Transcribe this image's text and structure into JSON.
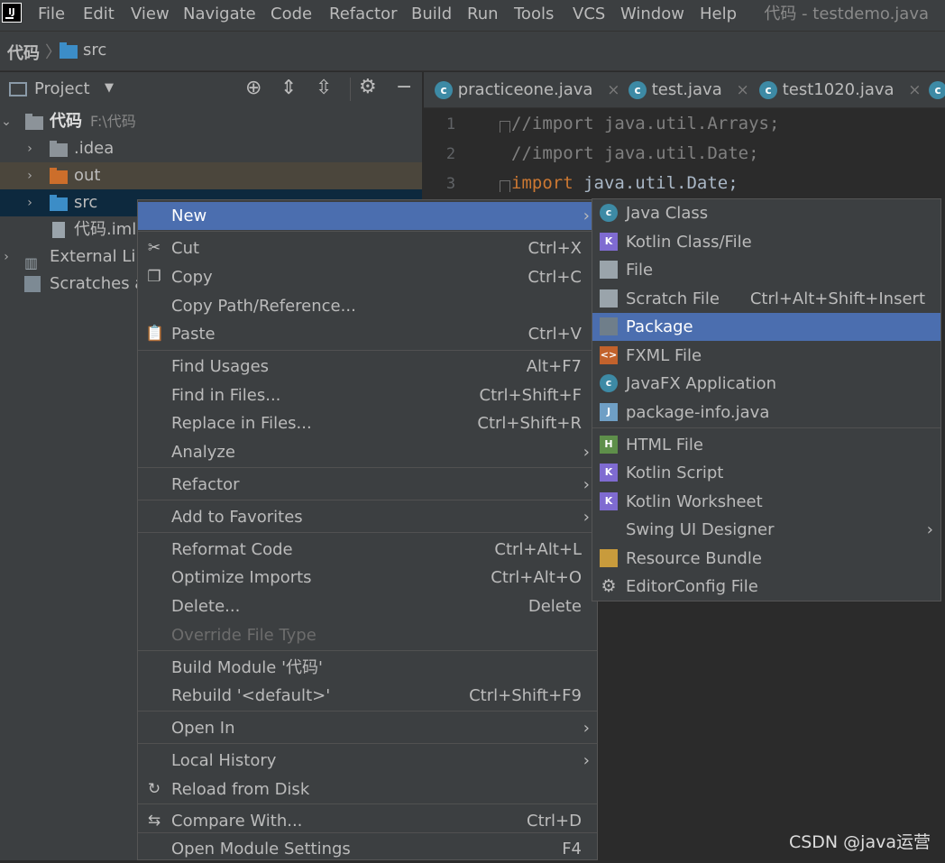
{
  "window_title": "代码 - testdemo.java",
  "menubar": [
    {
      "label": "File",
      "key": "F"
    },
    {
      "label": "Edit",
      "key": "E"
    },
    {
      "label": "View",
      "key": "V"
    },
    {
      "label": "Navigate",
      "key": "N"
    },
    {
      "label": "Code",
      "key": "C"
    },
    {
      "label": "Refactor",
      "key": "R"
    },
    {
      "label": "Build",
      "key": "B"
    },
    {
      "label": "Run",
      "key": "u"
    },
    {
      "label": "Tools",
      "key": "T"
    },
    {
      "label": "VCS",
      "key": "S"
    },
    {
      "label": "Window",
      "key": "W"
    },
    {
      "label": "Help",
      "key": "H"
    }
  ],
  "breadcrumb": {
    "project": "代码",
    "folder": "src"
  },
  "project_panel": {
    "title": "Project",
    "tree": [
      {
        "label": "代码",
        "hint": "F:\\代码",
        "bold": true
      },
      {
        "label": ".idea"
      },
      {
        "label": "out"
      },
      {
        "label": "src"
      },
      {
        "label": "代码.iml"
      },
      {
        "label": "External Lib"
      },
      {
        "label": "Scratches a"
      }
    ]
  },
  "tabs": [
    {
      "label": "practiceone.java"
    },
    {
      "label": "test.java"
    },
    {
      "label": "test1020.java"
    }
  ],
  "editor": {
    "lines": [
      {
        "num": "1",
        "text": "//import java.util.Arrays;",
        "comment": true
      },
      {
        "num": "2",
        "text": "//import java.util.Date;",
        "comment": true
      },
      {
        "num": "3",
        "keyword": "import",
        "text": " java.util.Date;",
        "comment": false
      }
    ]
  },
  "context_menu": {
    "items": [
      {
        "label": "New",
        "shortcut": "",
        "submenu": true,
        "selected": true
      },
      {
        "label": "Cut",
        "shortcut": "Ctrl+X",
        "icon": "scissors-icon"
      },
      {
        "label": "Copy",
        "shortcut": "Ctrl+C",
        "icon": "copy-icon"
      },
      {
        "label": "Copy Path/Reference...",
        "shortcut": ""
      },
      {
        "label": "Paste",
        "shortcut": "Ctrl+V",
        "icon": "paste-icon"
      },
      {
        "label": "Find Usages",
        "shortcut": "Alt+F7"
      },
      {
        "label": "Find in Files...",
        "shortcut": "Ctrl+Shift+F"
      },
      {
        "label": "Replace in Files...",
        "shortcut": "Ctrl+Shift+R"
      },
      {
        "label": "Analyze",
        "shortcut": "",
        "submenu": true
      },
      {
        "label": "Refactor",
        "shortcut": "",
        "submenu": true
      },
      {
        "label": "Add to Favorites",
        "shortcut": "",
        "submenu": true
      },
      {
        "label": "Reformat Code",
        "shortcut": "Ctrl+Alt+L"
      },
      {
        "label": "Optimize Imports",
        "shortcut": "Ctrl+Alt+O"
      },
      {
        "label": "Delete...",
        "shortcut": "Delete"
      },
      {
        "label": "Override File Type",
        "shortcut": "",
        "disabled": true
      },
      {
        "label": "Build Module '代码'",
        "shortcut": ""
      },
      {
        "label": "Rebuild '<default>'",
        "shortcut": "Ctrl+Shift+F9"
      },
      {
        "label": "Open In",
        "shortcut": "",
        "submenu": true
      },
      {
        "label": "Local History",
        "shortcut": "",
        "submenu": true
      },
      {
        "label": "Reload from Disk",
        "shortcut": "",
        "icon": "reload-icon"
      },
      {
        "label": "Compare With...",
        "shortcut": "Ctrl+D",
        "icon": "compare-icon"
      },
      {
        "label": "Open Module Settings",
        "shortcut": "F4"
      }
    ]
  },
  "new_submenu": {
    "items": [
      {
        "label": "Java Class",
        "shortcut": "",
        "icon": "java-class-icon"
      },
      {
        "label": "Kotlin Class/File",
        "shortcut": "",
        "icon": "kotlin-file-icon"
      },
      {
        "label": "File",
        "shortcut": "",
        "icon": "file-icon"
      },
      {
        "label": "Scratch File",
        "shortcut": "Ctrl+Alt+Shift+Insert",
        "icon": "scratch-file-icon"
      },
      {
        "label": "Package",
        "shortcut": "",
        "icon": "package-icon",
        "selected": true
      },
      {
        "label": "FXML File",
        "shortcut": "",
        "icon": "fxml-file-icon"
      },
      {
        "label": "JavaFX Application",
        "shortcut": "",
        "icon": "javafx-app-icon"
      },
      {
        "label": "package-info.java",
        "shortcut": "",
        "icon": "package-info-icon"
      },
      {
        "label": "HTML File",
        "shortcut": "",
        "icon": "html-file-icon"
      },
      {
        "label": "Kotlin Script",
        "shortcut": "",
        "icon": "kotlin-script-icon"
      },
      {
        "label": "Kotlin Worksheet",
        "shortcut": "",
        "icon": "kotlin-worksheet-icon"
      },
      {
        "label": "Swing UI Designer",
        "shortcut": "",
        "submenu": true
      },
      {
        "label": "Resource Bundle",
        "shortcut": "",
        "icon": "resource-bundle-icon"
      },
      {
        "label": "EditorConfig File",
        "shortcut": "",
        "icon": "gear-icon"
      }
    ]
  },
  "watermark": "CSDN @java运营",
  "colors": {
    "menu_bg": "#3c3f41",
    "selection": "#4b6eaf",
    "editor_bg": "#2b2b2b",
    "keyword": "#cc7832",
    "comment": "#808080"
  }
}
